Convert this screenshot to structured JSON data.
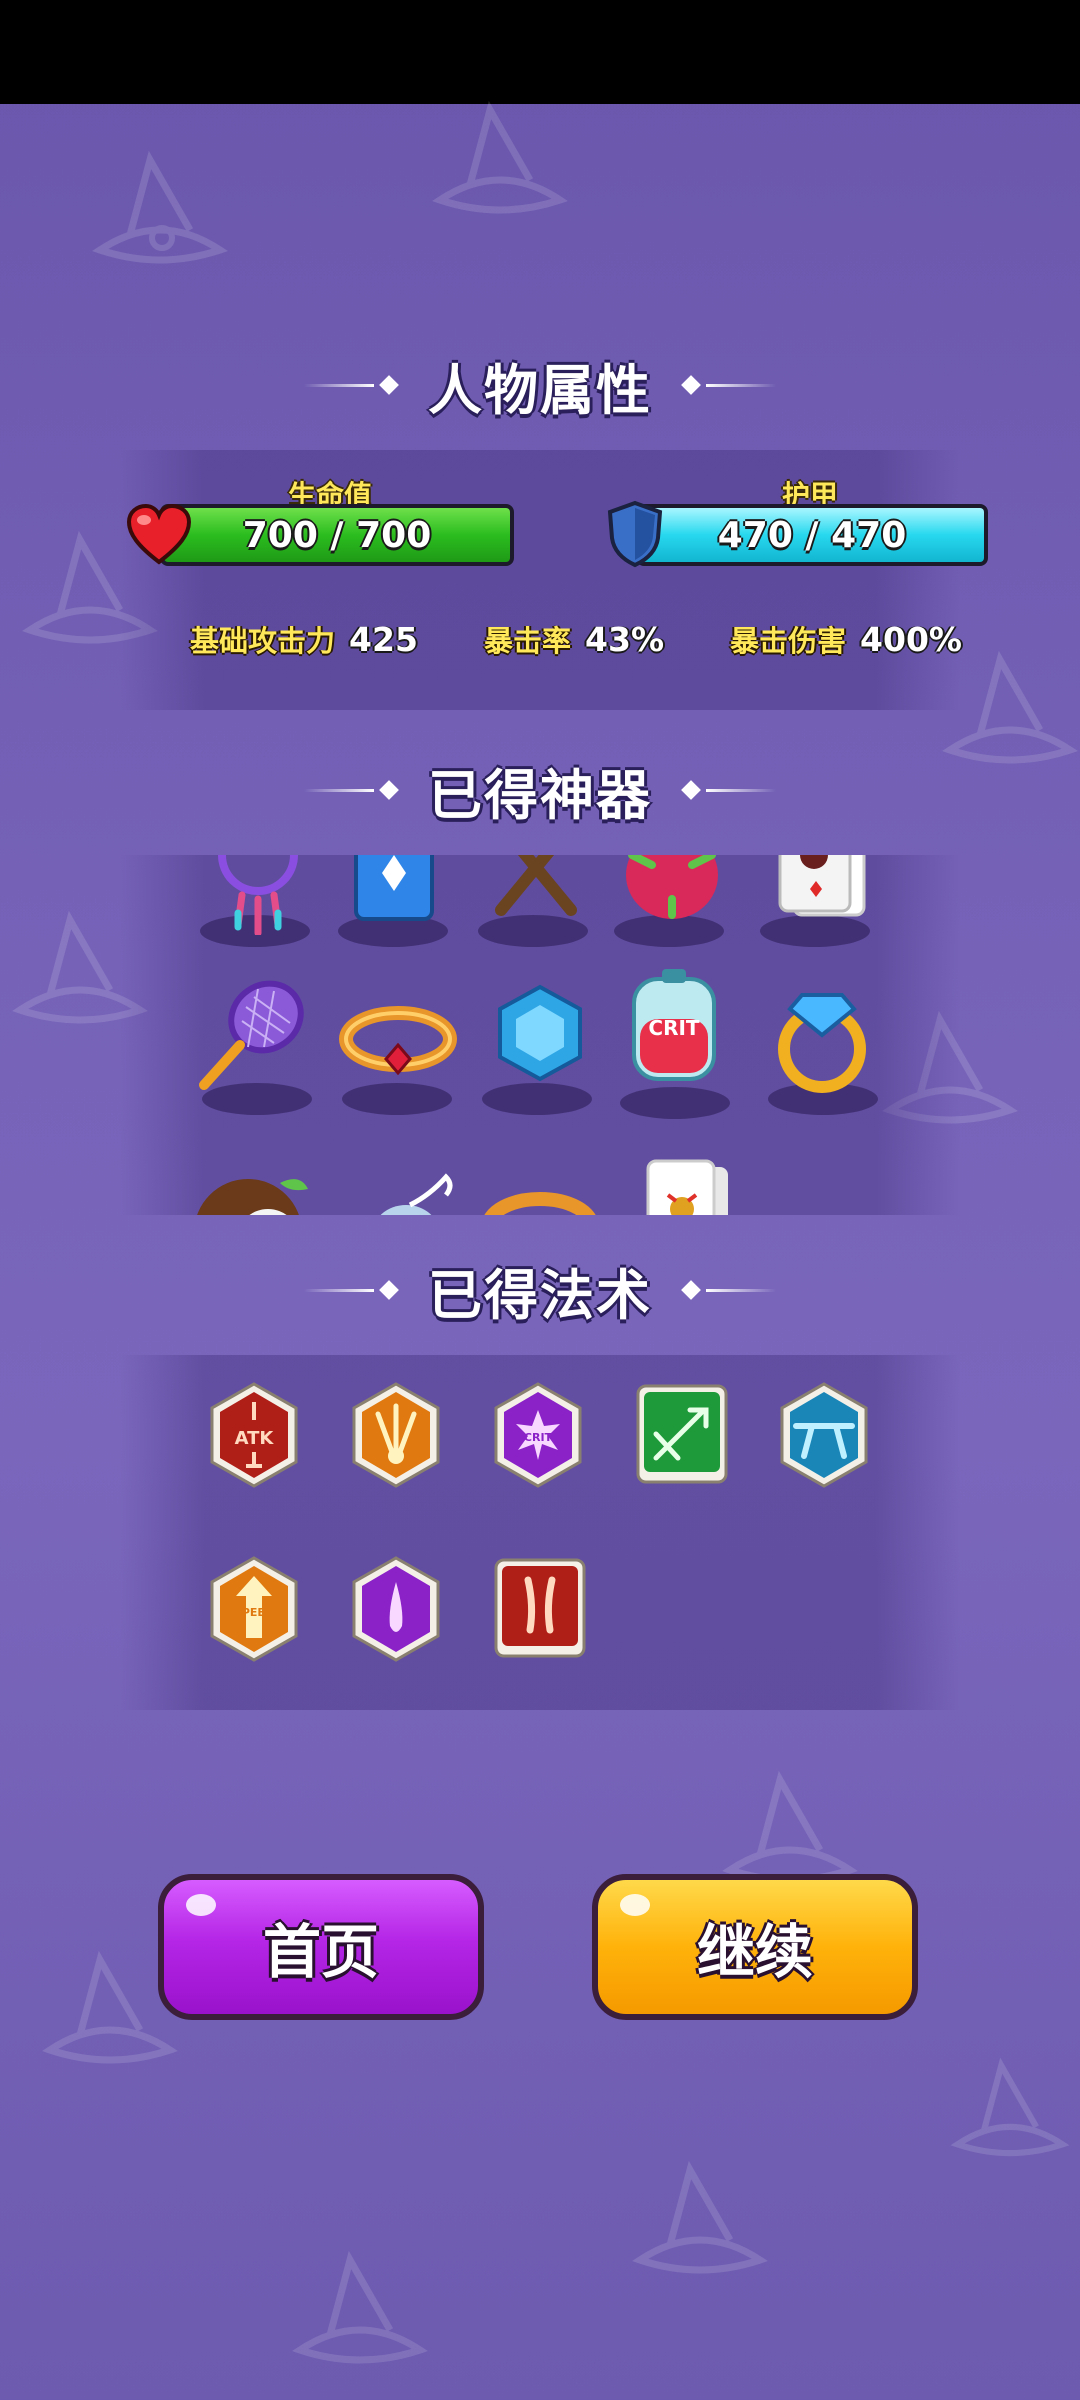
{
  "titles": {
    "attributes": "人物属性",
    "artifacts": "已得神器",
    "spells": "已得法术"
  },
  "health": {
    "label": "生命值",
    "value_text": "700 / 700",
    "fill_fraction": 1.0,
    "color": "#2bbd1f"
  },
  "armor": {
    "label": "护甲",
    "value_text": "470 / 470",
    "fill_fraction": 1.0,
    "color": "#27d8ee"
  },
  "stats": [
    {
      "label": "基础攻击力",
      "value": "425"
    },
    {
      "label": "暴击率",
      "value": "43%"
    },
    {
      "label": "暴击伤害",
      "value": "400%"
    }
  ],
  "artifacts": {
    "row1": [
      "dreamcatcher-icon",
      "blue-card-icon",
      "crossed-axes-icon",
      "dragonfruit-icon",
      "playing-card-icon"
    ],
    "row2": [
      "tennis-racket-icon",
      "ruby-bracelet-icon",
      "blue-gem-icon",
      "crit-potion-icon",
      "diamond-ring-icon"
    ],
    "row3": [
      "coconut-icon",
      "pouch-icon",
      "emerald-bracelet-icon",
      "joker-card-icon"
    ],
    "crit_text": "CRIT"
  },
  "spells": {
    "row1": [
      "atk-up-spell-icon",
      "triple-shot-spell-icon",
      "crit-burst-spell-icon",
      "bounce-spell-icon",
      "pierce-spell-icon"
    ],
    "row2": [
      "speed-up-spell-icon",
      "purple-drop-spell-icon",
      "double-claw-spell-icon"
    ],
    "atk_text": "ATK",
    "crit_text": "CRIT",
    "speed_text": "SPEED"
  },
  "buttons": {
    "home": "首页",
    "continue": "继续"
  },
  "colors": {
    "home_button": "#b526e6",
    "continue_button": "#ffb20a",
    "background": "#7060b4"
  }
}
